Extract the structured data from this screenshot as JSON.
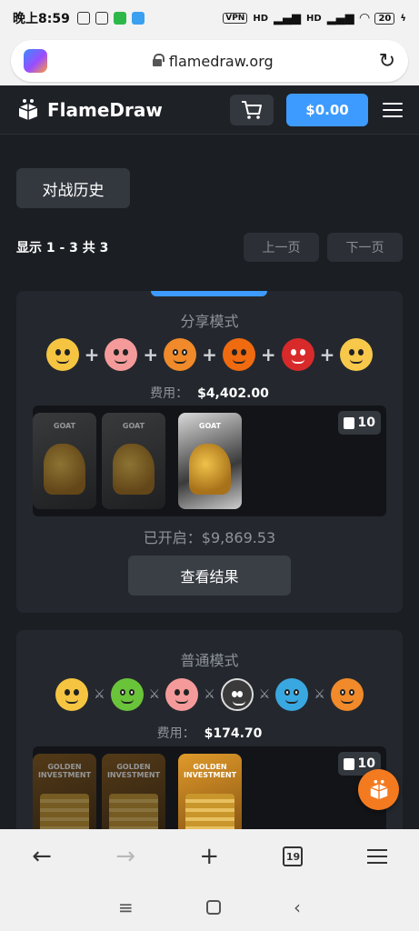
{
  "status_bar": {
    "time": "晚上8:59",
    "vpn": "VPN",
    "signal1": "HD",
    "signal2": "HD",
    "battery": "20"
  },
  "browser": {
    "url": "flamedraw.org",
    "tabs_count": "19"
  },
  "header": {
    "logo_text": "FlameDraw",
    "balance": "$0.00"
  },
  "history_button": "对战历史",
  "pagination": {
    "info": "显示 1 - 3 共 3",
    "prev": "上一页",
    "next": "下一页"
  },
  "battles": [
    {
      "mode": "分享模式",
      "cost_label": "费用：",
      "cost_value": "$4,402.00",
      "case_label": "GOAT",
      "case_count": "10",
      "opened": "已开启：$9,869.53",
      "view_button": "查看结果"
    },
    {
      "mode": "普通模式",
      "cost_label": "费用：",
      "cost_value": "$174.70",
      "case_label": "GOLDEN INVESTMENT",
      "case_count": "10"
    }
  ],
  "colors": {
    "accent": "#3d9bff",
    "fab": "#f47a1f"
  }
}
